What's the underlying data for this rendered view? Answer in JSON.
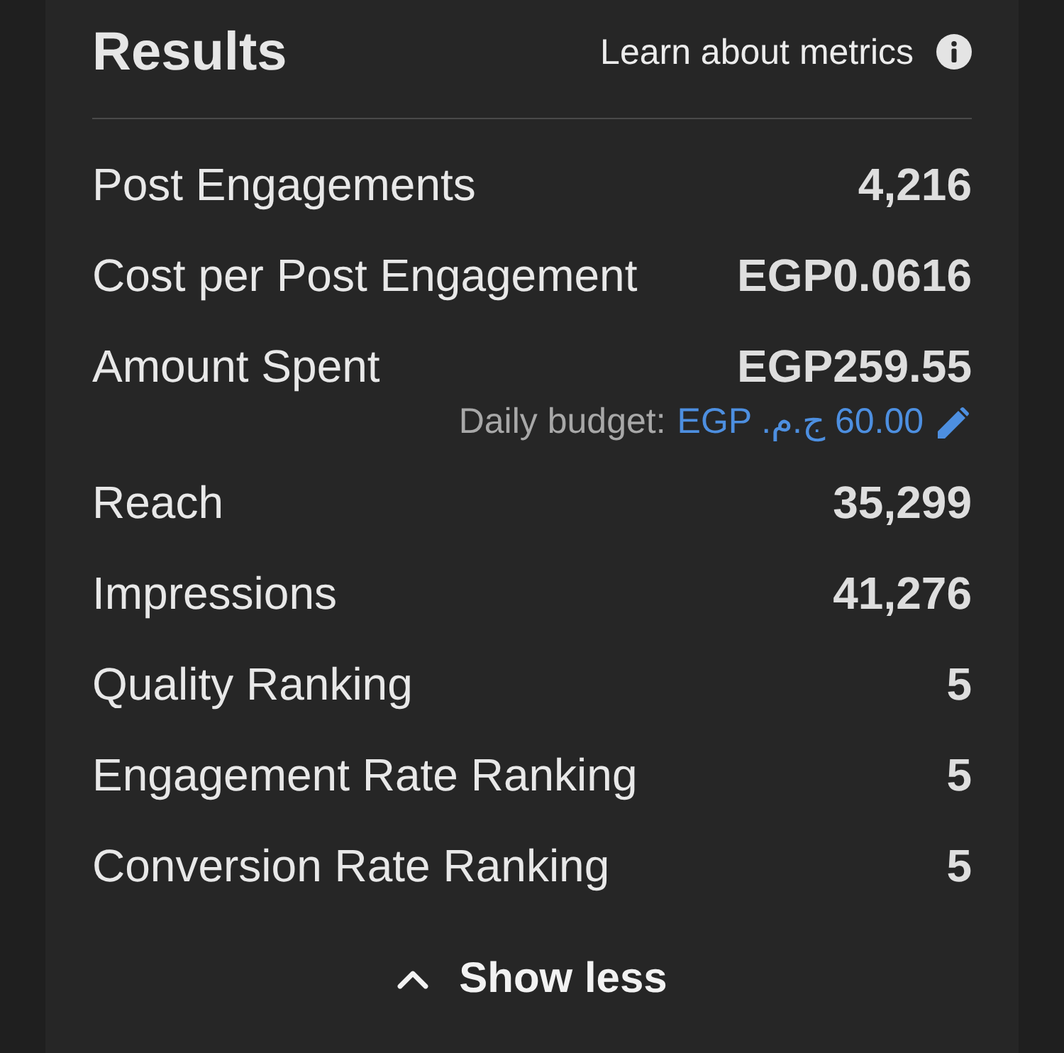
{
  "header": {
    "title": "Results",
    "link": "Learn about metrics"
  },
  "metrics": [
    {
      "label": "Post Engagements",
      "value": "4,216"
    },
    {
      "label": "Cost per Post Engagement",
      "value": "EGP0.0616"
    },
    {
      "label": "Amount Spent",
      "value": "EGP259.55",
      "budget": {
        "label": "Daily budget:",
        "currency": "EGP",
        "symbol": "ج.م.",
        "amount": "60.00"
      }
    },
    {
      "label": "Reach",
      "value": "35,299"
    },
    {
      "label": "Impressions",
      "value": "41,276"
    },
    {
      "label": "Quality Ranking",
      "value": "5"
    },
    {
      "label": "Engagement Rate Ranking",
      "value": "5"
    },
    {
      "label": "Conversion Rate Ranking",
      "value": "5"
    }
  ],
  "toggle": {
    "label": "Show less",
    "expanded": true
  }
}
